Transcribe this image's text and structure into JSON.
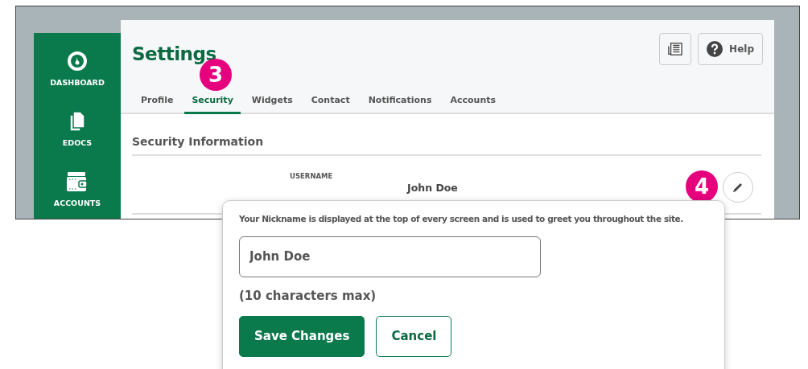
{
  "sidebar": {
    "items": [
      {
        "label": "DASHBOARD"
      },
      {
        "label": "EDOCS"
      },
      {
        "label": "ACCOUNTS"
      }
    ]
  },
  "header": {
    "title": "Settings",
    "help_button": "Help"
  },
  "tabs": [
    {
      "label": "Profile",
      "selected": false
    },
    {
      "label": "Security",
      "selected": true
    },
    {
      "label": "Widgets",
      "selected": false
    },
    {
      "label": "Contact",
      "selected": false
    },
    {
      "label": "Notifications",
      "selected": false
    },
    {
      "label": "Accounts",
      "selected": false
    }
  ],
  "section": {
    "title": "Security Information",
    "field_label": "USERNAME",
    "field_value": "John Doe"
  },
  "callouts": [
    "3",
    "4"
  ],
  "popup": {
    "description": "Your Nickname is displayed at the top of every screen and is used to greet you throughout the site.",
    "input_value": "John Doe",
    "hint": "(10 characters max)",
    "buttons": [
      {
        "label": "Save Changes",
        "kind": "primary"
      },
      {
        "label": "Cancel",
        "kind": "secondary"
      }
    ]
  }
}
